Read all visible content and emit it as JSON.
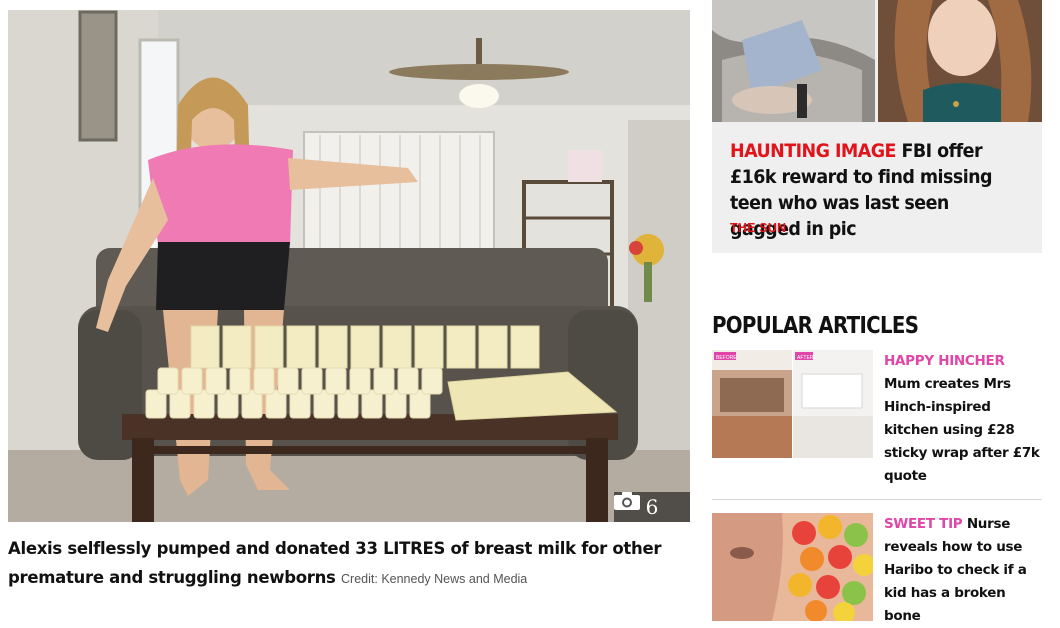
{
  "hero": {
    "gallery_count": "6",
    "caption": "Alexis selflessly pumped and donated 33 LITRES of breast milk for other premature and struggling newborns",
    "credit": "Credit: Kennedy News and Media"
  },
  "promo": {
    "kicker": "HAUNTING IMAGE",
    "headline": "FBI offer £16k reward to find missing teen who was last seen gagged in pic",
    "source": "THE SUN"
  },
  "popular": {
    "heading": "POPULAR ARTICLES",
    "articles": [
      {
        "kicker": "HAPPY HINCHER",
        "headline": "Mum creates Mrs Hinch-inspired kitchen using £28 sticky wrap after £7k quote",
        "thumb_left_tag": "BEFORE",
        "thumb_right_tag": "AFTER"
      },
      {
        "kicker": "SWEET TIP",
        "headline": "Nurse reveals how to use Haribo to check if a kid has a broken bone"
      }
    ]
  },
  "colors": {
    "kicker_red": "#e2141b",
    "kicker_pink": "#e046a8",
    "promo_bg": "#efefef"
  }
}
